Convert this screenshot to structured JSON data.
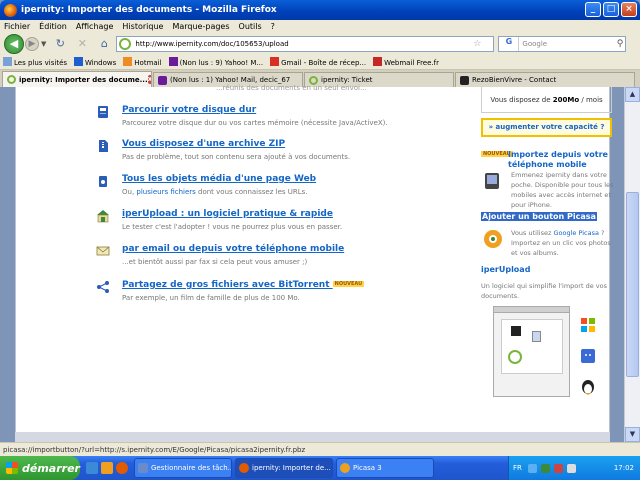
{
  "window": {
    "title": "ipernity: Importer des documents - Mozilla Firefox",
    "controls": {
      "minimize": "_",
      "maximize": "□",
      "close": "×"
    }
  },
  "menu": [
    "Fichier",
    "Édition",
    "Affichage",
    "Historique",
    "Marque-pages",
    "Outils",
    "?"
  ],
  "nav": {
    "url": "http://www.ipernity.com/doc/105653/upload",
    "search_placeholder": "Google",
    "search_engine": "G"
  },
  "bookmarks": [
    {
      "label": "Les plus visités",
      "color": "#7aa0d8"
    },
    {
      "label": "Windows",
      "color": "#1e5fd0"
    },
    {
      "label": "Hotmail",
      "color": "#f08a24"
    },
    {
      "label": "(Non lus : 9) Yahoo! M...",
      "color": "#6a1b9a"
    },
    {
      "label": "Gmail - Boîte de récep...",
      "color": "#d93025"
    },
    {
      "label": "Webmail Free.fr",
      "color": "#c62828"
    }
  ],
  "tabs": [
    {
      "label": "ipernity: Importer des docume...",
      "active": true,
      "color": "#7ab43a",
      "has_close": true
    },
    {
      "label": "(Non lus : 1) Yahoo! Mail, decic_67",
      "active": false,
      "color": "#6a1b9a"
    },
    {
      "label": "ipernity: Ticket",
      "active": false,
      "color": "#7ab43a"
    },
    {
      "label": "RezoBienVivre - Contact",
      "active": false,
      "color": "#222222"
    }
  ],
  "tab_close_glyph": "x",
  "page": {
    "cut_text": "...réunis des documents en un seul envoi...",
    "options": [
      {
        "title": "Parcourir votre disque dur",
        "desc": "Parcourez votre disque dur ou vos cartes mémoire (nécessite Java/ActiveX).",
        "icon": "hard-disk-icon",
        "icon_color": "#2a5cb8"
      },
      {
        "title": "Vous disposez d'une archive ZIP",
        "desc": "Pas de problème, tout son contenu sera ajouté à vos documents.",
        "icon": "zip-archive-icon",
        "icon_color": "#2a5cb8"
      },
      {
        "title": "Tous les objets média d'une page Web",
        "desc_prefix": "Ou, ",
        "desc_link": "plusieurs fichiers",
        "desc_suffix": " dont vous connaissez les URLs.",
        "icon": "media-icon",
        "icon_color": "#2a5cb8"
      },
      {
        "title": "iperUpload : un logiciel pratique & rapide",
        "desc": "Le tester c'est l'adopter ! vous ne pourrez plus vous en passer.",
        "icon": "software-icon",
        "icon_color": "#3a8a3a"
      },
      {
        "title": "par email ou depuis votre téléphone mobile",
        "desc": "...et bientôt aussi par fax si cela peut vous amuser ;)",
        "icon": "email-icon",
        "icon_color": "#8a7a3a"
      },
      {
        "title": "Partagez de gros fichiers avec BitTorrent",
        "badge": "NOUVEAU",
        "desc": "Par exemple, un film de famille de plus de 100 Mo.",
        "icon": "bittorrent-icon",
        "icon_color": "#2a5cb8"
      }
    ]
  },
  "sidebar": {
    "quota_prefix": "Vous disposez de ",
    "quota_value": "200Mo",
    "quota_suffix": " / mois",
    "upgrade": "» augmenter votre capacité ?",
    "mobile_badge": "NOUVEAU",
    "mobile_title": "Importez depuis votre téléphone mobile",
    "mobile_desc": "Emmenez ipernity dans votre poche. Disponible pour tous les mobiles avec accès internet et pour iPhone.",
    "picasa_title": "Ajouter un bouton Picasa",
    "picasa_desc_prefix": "Vous utilisez ",
    "picasa_link": "Google Picasa",
    "picasa_desc_suffix": " ? Importez en un clic vos photos et vos albums.",
    "iper_title": "iperUpload",
    "iper_desc": "Un logiciel qui simplifie l'import de vos documents.",
    "os_icons": [
      "windows-icon",
      "mac-icon",
      "linux-icon"
    ]
  },
  "status": "picasa://importbutton/?url=http://s.ipernity.com/E/Google/Picasa/picasa2ipernity.fr.pbz",
  "taskbar": {
    "start": "démarrer",
    "tasks": [
      {
        "label": "Gestionnaire des tâch...",
        "color": "#6a8ac8",
        "active": false
      },
      {
        "label": "ipernity: Importer de...",
        "color": "#e35b00",
        "active": true
      },
      {
        "label": "Picasa 3",
        "color": "#f0a020",
        "active": false
      }
    ],
    "lang": "FR",
    "clock": "17:02"
  }
}
